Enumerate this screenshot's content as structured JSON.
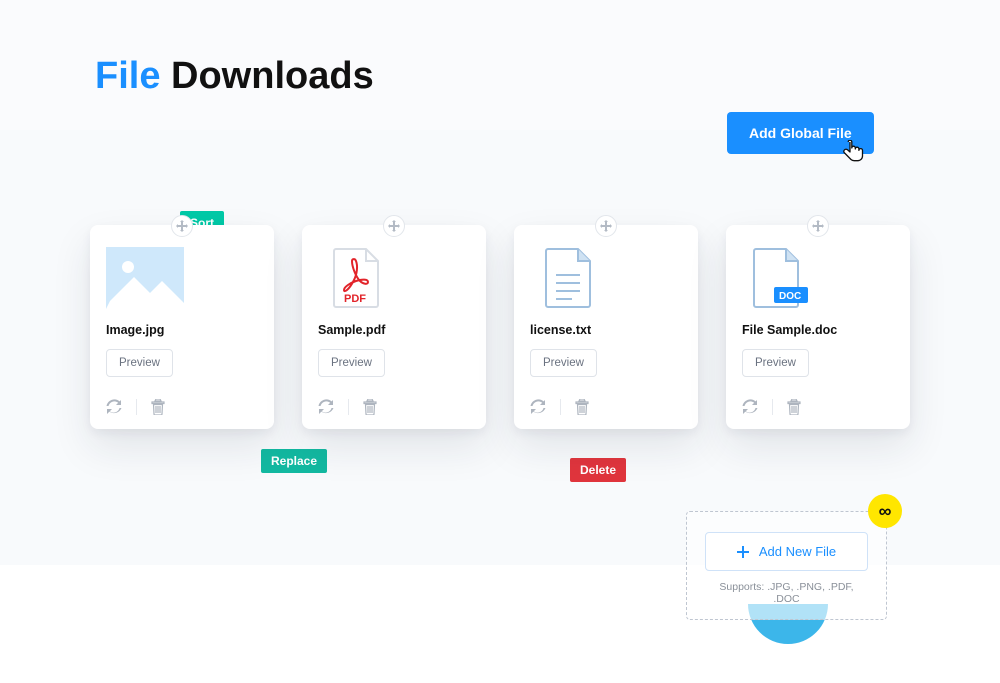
{
  "title_highlight": "File",
  "title_rest": " Downloads",
  "add_global_label": "Add Global File",
  "preview_label": "Preview",
  "tags": {
    "sort": "Sort",
    "replace": "Replace",
    "delete": "Delete"
  },
  "cards": [
    {
      "filename": "Image.jpg"
    },
    {
      "filename": "Sample.pdf"
    },
    {
      "filename": "license.txt"
    },
    {
      "filename": "File Sample.doc"
    }
  ],
  "add_new": {
    "button": "Add New File",
    "supports": "Supports: .JPG, .PNG, .PDF, .DOC"
  }
}
